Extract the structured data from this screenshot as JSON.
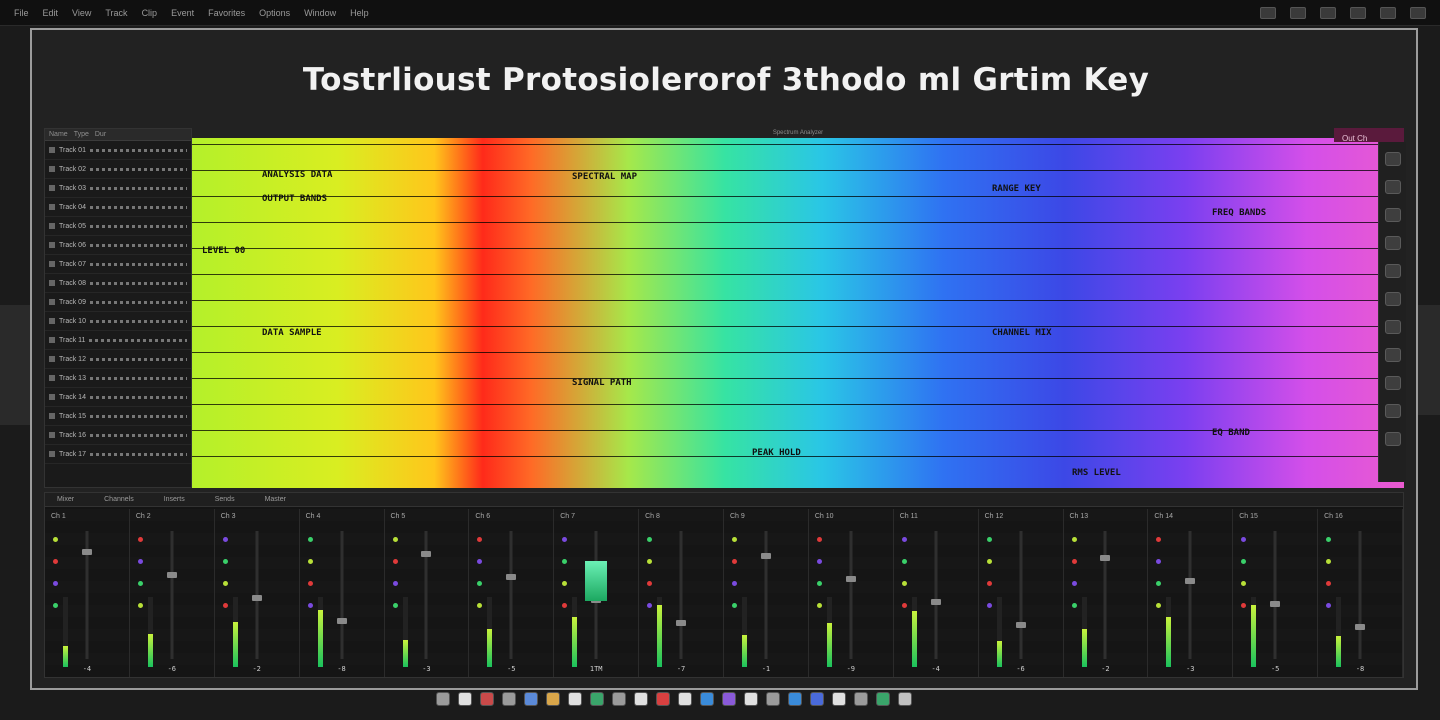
{
  "app": {
    "title": "Tostrlioust Protosiolerorof 3thodo ml Grtim Key"
  },
  "topbar": {
    "menu_items": [
      "File",
      "Edit",
      "View",
      "Track",
      "Clip",
      "Event",
      "Favorites",
      "Options",
      "Window",
      "Help"
    ],
    "toolbar_buttons": [
      "tb-1",
      "tb-2",
      "tb-3",
      "tb-4",
      "tb-5",
      "tb-6"
    ]
  },
  "left_panel": {
    "header": [
      "Name",
      "Type",
      "Dur"
    ],
    "rows": [
      "Track 01",
      "Track 02",
      "Track 03",
      "Track 04",
      "Track 05",
      "Track 06",
      "Track 07",
      "Track 08",
      "Track 09",
      "Track 10",
      "Track 11",
      "Track 12",
      "Track 13",
      "Track 14",
      "Track 15",
      "Track 16",
      "Track 17"
    ]
  },
  "spectrum": {
    "header": "Spectrum Analyzer",
    "right_tab": "Out Ch",
    "labels": [
      "ANALYSIS DATA",
      "OUTPUT BANDS",
      "LEVEL 00",
      "SPECTRAL MAP",
      "RANGE KEY",
      "FREQ BANDS",
      "DATA SAMPLE",
      "SIGNAL PATH",
      "CHANNEL MIX",
      "EQ BAND",
      "PEAK HOLD",
      "RMS LEVEL"
    ]
  },
  "mixer": {
    "header": [
      "Mixer",
      "Channels",
      "Inserts",
      "Sends",
      "Master"
    ],
    "channels": [
      {
        "name": "Ch 1",
        "value": "-4"
      },
      {
        "name": "Ch 2",
        "value": "-6"
      },
      {
        "name": "Ch 3",
        "value": "-2"
      },
      {
        "name": "Ch 4",
        "value": "-8"
      },
      {
        "name": "Ch 5",
        "value": "-3"
      },
      {
        "name": "Ch 6",
        "value": "-5"
      },
      {
        "name": "Ch 7",
        "value": "1TM"
      },
      {
        "name": "Ch 8",
        "value": "-7"
      },
      {
        "name": "Ch 9",
        "value": "-1"
      },
      {
        "name": "Ch 10",
        "value": "-9"
      },
      {
        "name": "Ch 11",
        "value": "-4"
      },
      {
        "name": "Ch 12",
        "value": "-6"
      },
      {
        "name": "Ch 13",
        "value": "-2"
      },
      {
        "name": "Ch 14",
        "value": "-3"
      },
      {
        "name": "Ch 15",
        "value": "-5"
      },
      {
        "name": "Ch 16",
        "value": "-8"
      }
    ]
  },
  "dock": {
    "apps": [
      "#9b9b9b",
      "#e0e0e0",
      "#c94a4a",
      "#9b9b9b",
      "#5b8ad9",
      "#d9a64a",
      "#e0e0e0",
      "#3aa46a",
      "#9b9b9b",
      "#e0e0e0",
      "#d84040",
      "#e0e0e0",
      "#3a8bd9",
      "#8a5ad9",
      "#e0e0e0",
      "#9b9b9b",
      "#3a8bd9",
      "#4a6ad9",
      "#e0e0e0",
      "#9b9b9b",
      "#3aa46a",
      "#c0c0c0"
    ]
  },
  "colors": {
    "frame": "#9c9c9c",
    "spectrum_start": "#b4f02a",
    "spectrum_end": "#ea5ad0"
  }
}
